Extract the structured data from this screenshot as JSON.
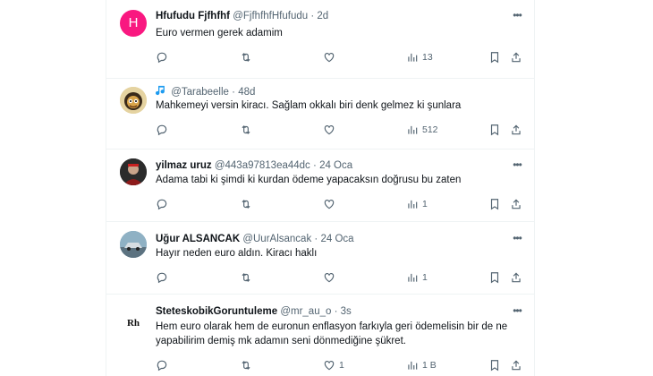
{
  "tweets": [
    {
      "avatar_letter": "H",
      "avatar_color": "#f91880",
      "name": "Hfufudu Fjfhfhf",
      "handle": "@FjfhfhfHfufudu",
      "time": "2d",
      "text": "Euro vermen gerek adamim",
      "views": "13",
      "likes": ""
    },
    {
      "avatar_icon": "cartoon-avatar",
      "handle": "@Tarabeelle",
      "time": "48d",
      "text": "Mahkemeyi versin kiracı. Sağlam okkalı biri denk gelmez ki şunlara",
      "views": "512",
      "likes": ""
    },
    {
      "avatar_icon": "photo-avatar",
      "name": "yilmaz uruz",
      "handle": "@443a97813ea44dc",
      "time": "24 Oca",
      "text": "Adama tabi ki şimdi ki kurdan ödeme yapacaksın doğrusu bu zaten",
      "views": "1",
      "likes": ""
    },
    {
      "avatar_icon": "car-photo-avatar",
      "name": "Uğur ALSANCAK",
      "handle": "@UurAlsancak",
      "time": "24 Oca",
      "text": "Hayır neden euro aldın. Kiracı haklı",
      "views": "1",
      "likes": ""
    },
    {
      "avatar_letter": "Rh",
      "name": "SteteskobikGoruntuleme",
      "handle": "@mr_au_o",
      "time": "3s",
      "text": "Hem euro olarak hem de euronun enflasyon farkıyla geri ödemelisin bir de ne yapabilirim demiş mk adamın seni dönmediğine şükret.",
      "views": "1 B",
      "likes": "1"
    }
  ],
  "separator_dot": "·",
  "more_glyph": "•••"
}
